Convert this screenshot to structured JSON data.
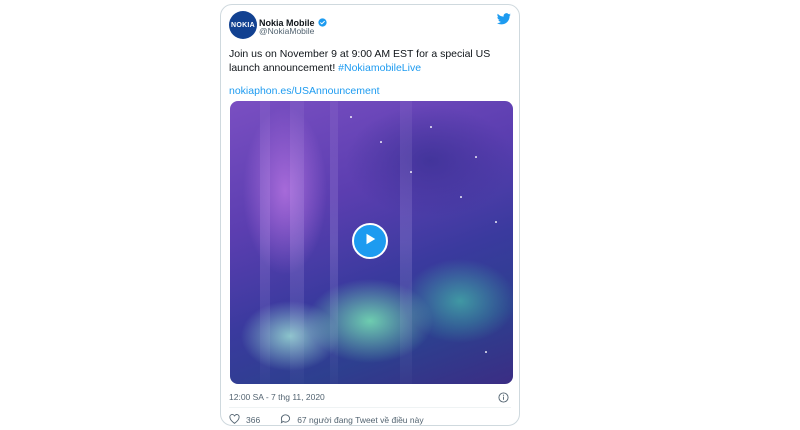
{
  "tweet": {
    "display_name": "Nokia Mobile",
    "handle": "@NokiaMobile",
    "avatar_text": "NOKIA",
    "text_main": "Join us on November 9 at 9:00 AM EST for a special US launch announcement! ",
    "hashtag": "#NokiamobileLive",
    "link": "nokiaphon.es/USAnnouncement",
    "timestamp": "12:00 SA - 7 thg 11, 2020",
    "likes": "366",
    "talking": "67 người đang Tweet về điều này"
  },
  "icons": {
    "verified": "verified-badge-icon",
    "logo": "twitter-bird-icon",
    "play": "play-icon",
    "info": "info-icon",
    "like": "heart-icon",
    "comment": "comment-icon"
  },
  "colors": {
    "link": "#1d9bf0",
    "avatar_bg": "#124191",
    "text": "#0f1419",
    "muted": "#536471"
  }
}
